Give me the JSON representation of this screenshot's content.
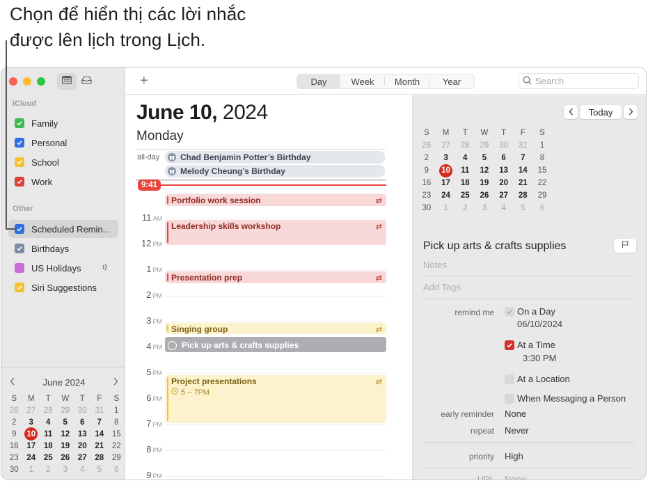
{
  "callout": {
    "line1": "Chọn để hiển thị các lời nhắc",
    "line2": "được lên lịch trong Lịch."
  },
  "sidebar": {
    "sections": [
      {
        "title": "iCloud"
      },
      {
        "title": "Other"
      }
    ],
    "calendars": [
      {
        "label": "Family",
        "color": "#3fb950",
        "checked": true,
        "section": "iCloud"
      },
      {
        "label": "Personal",
        "color": "#2f6fe4",
        "checked": true,
        "section": "iCloud"
      },
      {
        "label": "School",
        "color": "#f2c232",
        "checked": true,
        "section": "iCloud"
      },
      {
        "label": "Work",
        "color": "#e0403a",
        "checked": true,
        "section": "iCloud"
      },
      {
        "label": "Scheduled Remin...",
        "color": "#2f6fe4",
        "checked": true,
        "section": "Other",
        "selected": true
      },
      {
        "label": "Birthdays",
        "color": "#7e8aa3",
        "checked": true,
        "section": "Other"
      },
      {
        "label": "US Holidays",
        "color": "#c76ed8",
        "checked": false,
        "section": "Other",
        "trailing_icon": "broadcast-icon"
      },
      {
        "label": "Siri Suggestions",
        "color": "#f2c232",
        "checked": true,
        "section": "Other"
      }
    ],
    "mini_calendar": {
      "title": "June 2024",
      "prev_icon": "chevron-left-icon",
      "next_icon": "chevron-right-icon"
    }
  },
  "calendar": {
    "weekday_headers": [
      "S",
      "M",
      "T",
      "W",
      "T",
      "F",
      "S"
    ],
    "weeks": [
      [
        {
          "d": "26",
          "t": "out"
        },
        {
          "d": "27",
          "t": "out"
        },
        {
          "d": "28",
          "t": "out"
        },
        {
          "d": "29",
          "t": "out"
        },
        {
          "d": "30",
          "t": "out"
        },
        {
          "d": "31",
          "t": "out"
        },
        {
          "d": "1",
          "t": "wk"
        }
      ],
      [
        {
          "d": "2",
          "t": "wk"
        },
        {
          "d": "3",
          "t": "in"
        },
        {
          "d": "4",
          "t": "in"
        },
        {
          "d": "5",
          "t": "in"
        },
        {
          "d": "6",
          "t": "in"
        },
        {
          "d": "7",
          "t": "in"
        },
        {
          "d": "8",
          "t": "wk"
        }
      ],
      [
        {
          "d": "9",
          "t": "wk"
        },
        {
          "d": "10",
          "t": "today"
        },
        {
          "d": "11",
          "t": "in"
        },
        {
          "d": "12",
          "t": "in"
        },
        {
          "d": "13",
          "t": "in"
        },
        {
          "d": "14",
          "t": "in"
        },
        {
          "d": "15",
          "t": "wk"
        }
      ],
      [
        {
          "d": "16",
          "t": "wk"
        },
        {
          "d": "17",
          "t": "in"
        },
        {
          "d": "18",
          "t": "in"
        },
        {
          "d": "19",
          "t": "in"
        },
        {
          "d": "20",
          "t": "in"
        },
        {
          "d": "21",
          "t": "in"
        },
        {
          "d": "22",
          "t": "wk"
        }
      ],
      [
        {
          "d": "23",
          "t": "wk"
        },
        {
          "d": "24",
          "t": "in"
        },
        {
          "d": "25",
          "t": "in"
        },
        {
          "d": "26",
          "t": "in"
        },
        {
          "d": "27",
          "t": "in"
        },
        {
          "d": "28",
          "t": "in"
        },
        {
          "d": "29",
          "t": "wk"
        }
      ],
      [
        {
          "d": "30",
          "t": "wk"
        },
        {
          "d": "1",
          "t": "out"
        },
        {
          "d": "2",
          "t": "out"
        },
        {
          "d": "3",
          "t": "out"
        },
        {
          "d": "4",
          "t": "out"
        },
        {
          "d": "5",
          "t": "out"
        },
        {
          "d": "6",
          "t": "out"
        }
      ]
    ]
  },
  "toolbar": {
    "add_label": "+",
    "views": [
      "Day",
      "Week",
      "Month",
      "Year"
    ],
    "active_view": "Day",
    "search_placeholder": "Search"
  },
  "dayview": {
    "date_bold": "June 10,",
    "year": " 2024",
    "weekday": "Monday",
    "allday_label": "all-day",
    "allday_events": [
      "Chad Benjamin Potter’s Birthday",
      "Melody Cheung’s Birthday"
    ],
    "current_time": "9:41",
    "hours": [
      {
        "h": "11",
        "p": "AM"
      },
      {
        "h": "12",
        "p": "PM"
      },
      {
        "h": "1",
        "p": "PM"
      },
      {
        "h": "2",
        "p": "PM"
      },
      {
        "h": "3",
        "p": "PM"
      },
      {
        "h": "4",
        "p": "PM"
      },
      {
        "h": "5",
        "p": "PM"
      },
      {
        "h": "6",
        "p": "PM"
      },
      {
        "h": "7",
        "p": "PM"
      },
      {
        "h": "8",
        "p": "PM"
      },
      {
        "h": "9",
        "p": "PM"
      }
    ],
    "events": [
      {
        "title": "Portfolio work session",
        "calendar": "Work",
        "repeats": true
      },
      {
        "title": "Leadership skills workshop",
        "calendar": "Work",
        "repeats": true
      },
      {
        "title": "Presentation prep",
        "calendar": "Work",
        "repeats": true
      },
      {
        "title": "Singing group",
        "calendar": "School",
        "repeats": true
      },
      {
        "title": "Pick up arts & crafts supplies",
        "calendar": "Scheduled Reminders",
        "type": "reminder"
      },
      {
        "title": "Project presentations",
        "calendar": "School",
        "repeats": true,
        "time": "5 – 7PM"
      }
    ]
  },
  "right_panel": {
    "prev_label": "<",
    "today_label": "Today",
    "next_label": ">",
    "detail": {
      "title": "Pick up arts & crafts supplies",
      "notes_placeholder": "Notes",
      "tags_placeholder": "Add Tags",
      "remind_me_label": "remind me",
      "on_a_day": {
        "label": "On a Day",
        "checked": true,
        "disabled": true,
        "value": "06/10/2024"
      },
      "at_a_time": {
        "label": "At a Time",
        "checked": true,
        "value": "3:30 PM"
      },
      "at_a_location": {
        "label": "At a Location",
        "checked": false
      },
      "when_messaging": {
        "label": "When Messaging a Person",
        "checked": false
      },
      "early_reminder_label": "early reminder",
      "early_reminder_value": "None",
      "repeat_label": "repeat",
      "repeat_value": "Never",
      "priority_label": "priority",
      "priority_value": "High",
      "url_label": "URL",
      "url_value": "None"
    }
  }
}
